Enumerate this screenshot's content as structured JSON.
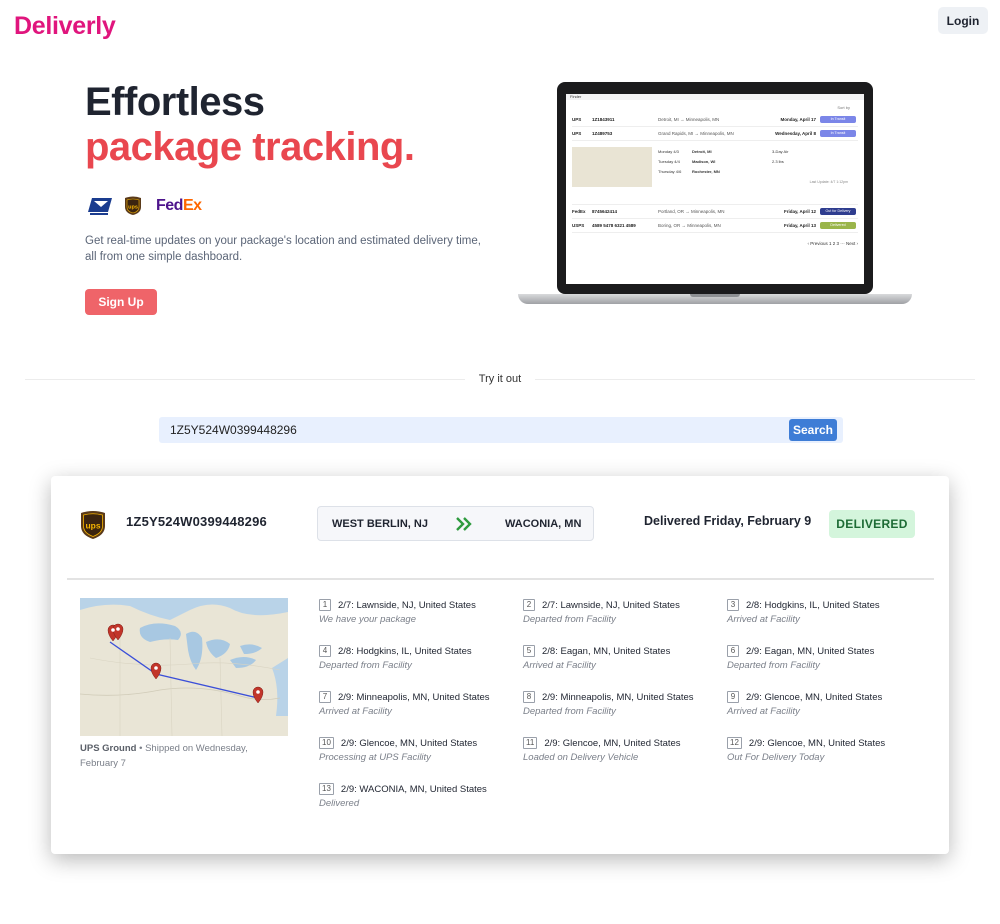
{
  "brand": "Deliverly",
  "nav": {
    "login_label": "Login"
  },
  "hero": {
    "title_line1": "Effortless",
    "title_line2": "package tracking.",
    "description": "Get real-time updates on your package's location and estimated delivery time, all from one simple dashboard.",
    "signup_label": "Sign Up",
    "carrier_icons": [
      "usps-icon",
      "ups-icon",
      "fedex-logo"
    ],
    "fedex_text_a": "Fed",
    "fedex_text_b": "Ex"
  },
  "laptop_preview": {
    "menubar": "Finder",
    "sort_label": "Sort by",
    "rows": [
      {
        "carrier": "UPS",
        "number": "1Z1843911",
        "route": "Detroit, MI → Minneapolis, MN",
        "date": "Monday, April 17",
        "status": "In Transit",
        "color": "#7b86e8"
      },
      {
        "carrier": "UPS",
        "number": "1Z489753",
        "route": "Grand Rapids, MI → Minneapolis, MN",
        "date": "Wednesday, April 8",
        "status": "In Transit",
        "color": "#7b86e8"
      },
      {
        "carrier": "FedEx",
        "number": "8745642414",
        "route": "Portland, OR → Minneapolis, MN",
        "date": "Friday, April 12",
        "status": "Out for Delivery",
        "color": "#2f3d8f"
      },
      {
        "carrier": "USPS",
        "number": "4589 5478 6321 4589",
        "route": "Boring, OR → Minneapolis, MN",
        "date": "Friday, April 13",
        "status": "Delivered",
        "color": "#9ab54a"
      }
    ],
    "expanded_lines": [
      {
        "day": "Monday 4/3",
        "place": "Detroit, MI",
        "note": "3-Day Air"
      },
      {
        "day": "Tuesday 4/4",
        "place": "Madison, WI",
        "note": "2.3 lbs"
      },
      {
        "day": "Thursday 4/6",
        "place": "Rochester, MN",
        "note": ""
      }
    ],
    "last_update": "Last Update: 4/7 1:12pm",
    "pager": "‹ Previous   1   2   3   ···   Next ›"
  },
  "try_it": {
    "label": "Try it out",
    "search_value": "1Z5Y524W0399448296",
    "search_button": "Search"
  },
  "result": {
    "carrier_icon": "ups-icon",
    "tracking_number": "1Z5Y524W0399448296",
    "origin": "WEST BERLIN, NJ",
    "destination": "WACONIA, MN",
    "delivered_text": "Delivered Friday, February 9",
    "status": "DELIVERED",
    "service": "UPS Ground",
    "shipped_text": " • Shipped on Wednesday, February 7",
    "events": [
      {
        "n": "1",
        "place": "2/7: Lawnside, NJ, United States",
        "status": "We have your package"
      },
      {
        "n": "2",
        "place": "2/7: Lawnside, NJ, United States",
        "status": "Departed from Facility"
      },
      {
        "n": "3",
        "place": "2/8: Hodgkins, IL, United States",
        "status": "Arrived at Facility"
      },
      {
        "n": "4",
        "place": "2/8: Hodgkins, IL, United States",
        "status": "Departed from Facility"
      },
      {
        "n": "5",
        "place": "2/8: Eagan, MN, United States",
        "status": "Arrived at Facility"
      },
      {
        "n": "6",
        "place": "2/9: Eagan, MN, United States",
        "status": "Departed from Facility"
      },
      {
        "n": "7",
        "place": "2/9: Minneapolis, MN, United States",
        "status": "Arrived at Facility"
      },
      {
        "n": "8",
        "place": "2/9: Minneapolis, MN, United States",
        "status": "Departed from Facility"
      },
      {
        "n": "9",
        "place": "2/9: Glencoe, MN, United States",
        "status": "Arrived at Facility"
      },
      {
        "n": "10",
        "place": "2/9: Glencoe, MN, United States",
        "status": "Processing at UPS Facility"
      },
      {
        "n": "11",
        "place": "2/9: Glencoe, MN, United States",
        "status": "Loaded on Delivery Vehicle"
      },
      {
        "n": "12",
        "place": "2/9: Glencoe, MN, United States",
        "status": "Out For Delivery Today"
      },
      {
        "n": "13",
        "place": "2/9: WACONIA, MN, United States",
        "status": "Delivered"
      }
    ]
  },
  "colors": {
    "brand": "#e0157d",
    "accent_red": "#e9474f",
    "search_blue": "#3e7dd6",
    "delivered_green_bg": "#d4f5dc",
    "route_arrow_green": "#2e9b3e"
  }
}
